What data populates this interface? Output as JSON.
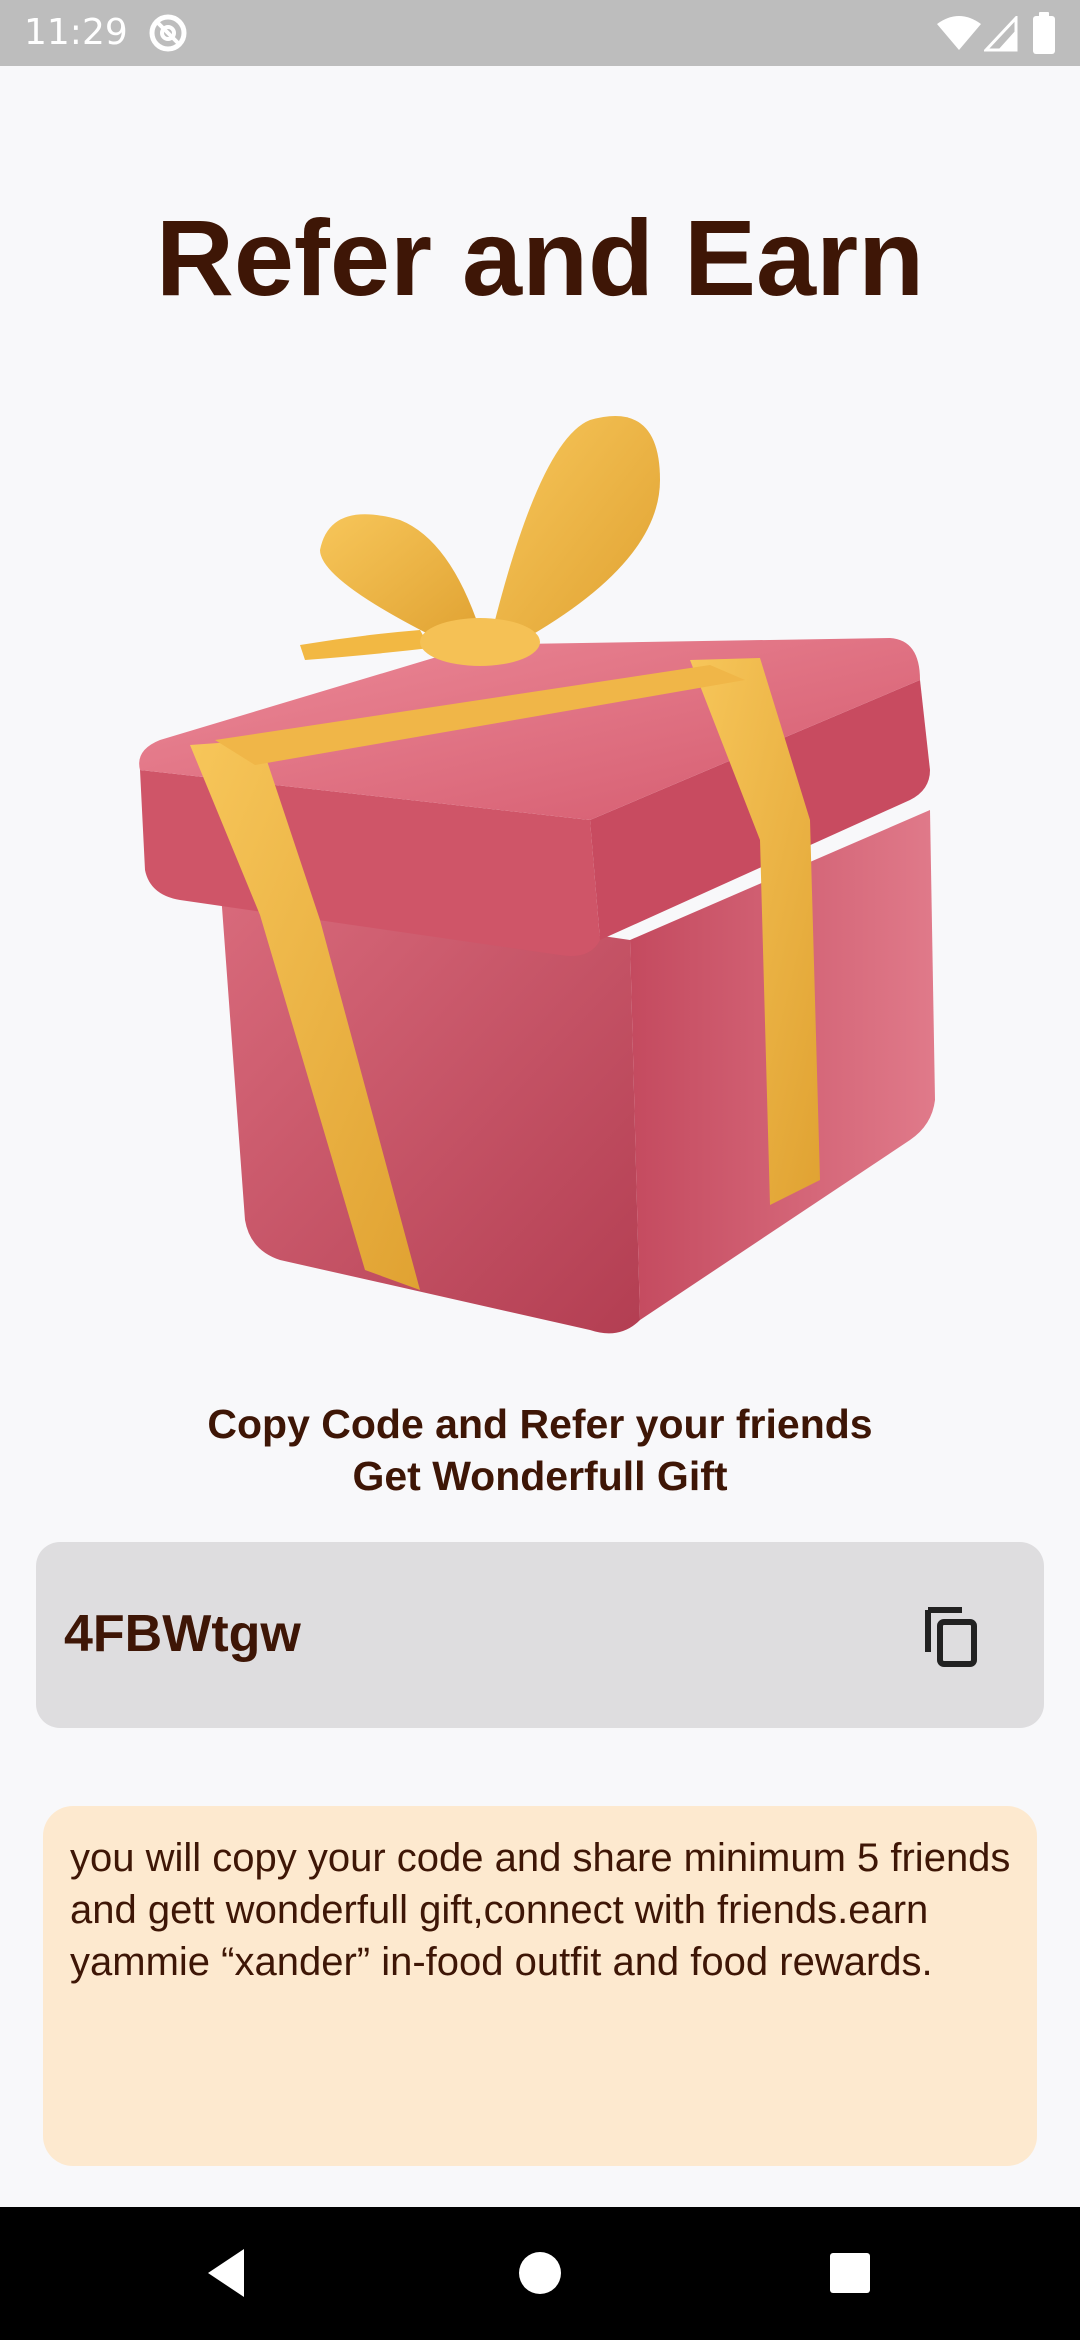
{
  "status_bar": {
    "time": "11:29",
    "icons": [
      "at-sign-icon",
      "wifi-icon",
      "signal-icon",
      "battery-icon"
    ]
  },
  "page": {
    "title": "Refer and Earn",
    "caption_line1": "Copy Code and Refer your friends",
    "caption_line2": "Get Wonderfull Gift",
    "referral_code": "4FBWtgw",
    "info_text": "you will copy your code and share minimum 5 friends and gett wonderfull gift,connect with friends.earn yammie “xander” in-food outfit and food rewards."
  },
  "colors": {
    "text_primary": "#3e1606",
    "code_box_bg": "#dedddf",
    "info_box_bg": "#fde9cf",
    "gift_box": "#d45a6e",
    "gift_ribbon": "#f2b843"
  },
  "nav_bar": {
    "buttons": [
      "back-icon",
      "home-icon",
      "recents-icon"
    ]
  }
}
